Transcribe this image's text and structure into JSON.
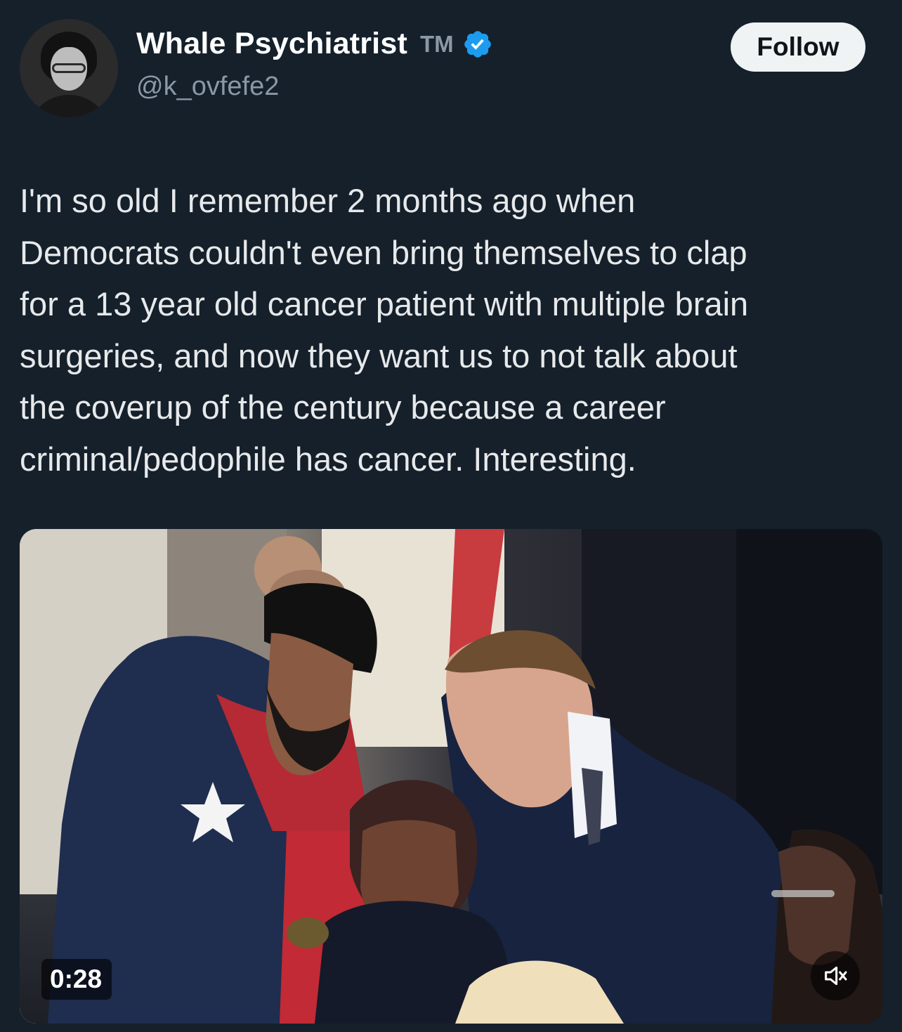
{
  "user": {
    "display_name": "Whale Psychiatrist",
    "name_suffix": "TM",
    "handle": "@k_ovfefe2",
    "verified_color": "#1d9bf0"
  },
  "actions": {
    "follow_label": "Follow"
  },
  "tweet": {
    "text": "I'm so old I remember 2 months ago when\nDemocrats couldn't even bring themselves to clap\nfor a 13 year old cancer patient with multiple brain\nsurgeries, and now they want us to not talk about\nthe coverup of the century because a career\ncriminal/pedophile has cancer. Interesting."
  },
  "media": {
    "duration": "0:28",
    "mute_icon": "speaker-muted-icon"
  },
  "colors": {
    "background": "#15202b",
    "text": "#e7e9ea",
    "secondary_text": "#8b98a5",
    "follow_button_bg": "#eff3f4"
  }
}
